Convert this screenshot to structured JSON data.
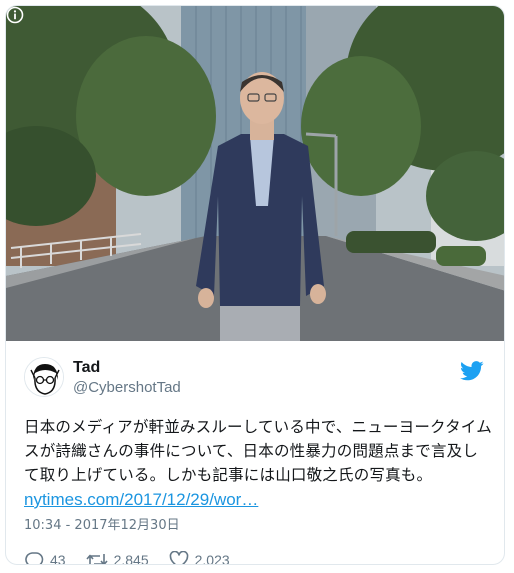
{
  "tweet": {
    "display_name": "Tad",
    "handle": "@CybershotTad",
    "text": "日本のメディアが軒並みスルーしている中で、ニューヨークタイムスが詩織さんの事件について、日本の性暴力の問題点まで言及して取り上げている。しかも記事には山口敬之氏の写真も。",
    "link": "nytimes.com/2017/12/29/wor…",
    "timestamp": "10:34 - 2017年12月30日",
    "replies": "43",
    "retweets": "2,845",
    "likes": "2,023"
  },
  "icons": {
    "info": "info-icon",
    "twitter": "twitter-bird-icon",
    "reply": "reply-icon",
    "retweet": "retweet-icon",
    "like": "heart-icon"
  },
  "colors": {
    "link": "#1b95e0",
    "secondary_text": "#657786",
    "bird": "#1da1f2"
  }
}
